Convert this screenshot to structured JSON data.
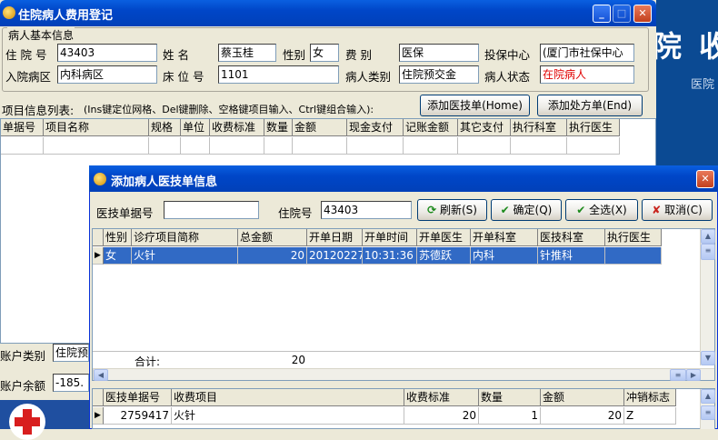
{
  "window": {
    "title": "住院病人费用登记"
  },
  "background": {
    "text_big": "院 收",
    "text_small": "医院"
  },
  "patient_group": {
    "caption": "病人基本信息",
    "fields": {
      "inpatient_no_label": "住 院 号",
      "inpatient_no": "43403",
      "name_label": "姓    名",
      "name": "蔡玉桂",
      "gender_label": "性别",
      "gender": "女",
      "fee_type_label": "费    别",
      "fee_type": "医保",
      "insurance_center_label": "投保中心",
      "insurance_center": "(厦门市社保中心",
      "ward_label": "入院病区",
      "ward": "内科病区",
      "bed_label": "床 位 号",
      "bed": "1101",
      "patient_type_label": "病人类别",
      "patient_type": "住院预交金",
      "patient_status_label": "病人状态",
      "patient_status": "在院病人"
    }
  },
  "items_section": {
    "label": "项目信息列表:",
    "hint": "(Ins键定位网格、Del键删除、空格键项目输入、Ctrl键组合输入):",
    "add_medtech_button": "添加医技单(Home)",
    "add_prescription_button": "添加处方单(End)",
    "columns": [
      "单据号",
      "项目名称",
      "规格",
      "单位",
      "收费标准",
      "数量",
      "金额",
      "现金支付",
      "记账金额",
      "其它支付",
      "执行科室",
      "执行医生"
    ]
  },
  "account": {
    "type_label": "账户类别",
    "type_value": "住院预",
    "balance_label": "账户余额",
    "balance_value": "-185."
  },
  "dialog": {
    "title": "添加病人医技单信息",
    "doc_no_label": "医技单据号",
    "doc_no_value": "",
    "inpatient_no_label": "住院号",
    "inpatient_no_value": "43403",
    "buttons": {
      "refresh": "刷新(S)",
      "confirm": "确定(Q)",
      "select_all": "全选(X)",
      "cancel": "取消(C)"
    },
    "upper_table": {
      "columns": [
        "性别",
        "诊疗项目简称",
        "总金额",
        "开单日期",
        "开单时间",
        "开单医生",
        "开单科室",
        "医技科室",
        "执行医生"
      ],
      "rows": [
        [
          "女",
          "火针",
          "20",
          "20120227",
          "10:31:36",
          "苏德跃",
          "内科",
          "针推科",
          ""
        ]
      ],
      "total_label": "合计:",
      "total_value": "20"
    },
    "lower_table": {
      "columns": [
        "医技单据号",
        "收费项目",
        "收费标准",
        "数量",
        "金额",
        "冲销标志"
      ],
      "rows": [
        [
          "2759417",
          "火针",
          "20",
          "1",
          "20",
          "Z"
        ]
      ]
    }
  }
}
